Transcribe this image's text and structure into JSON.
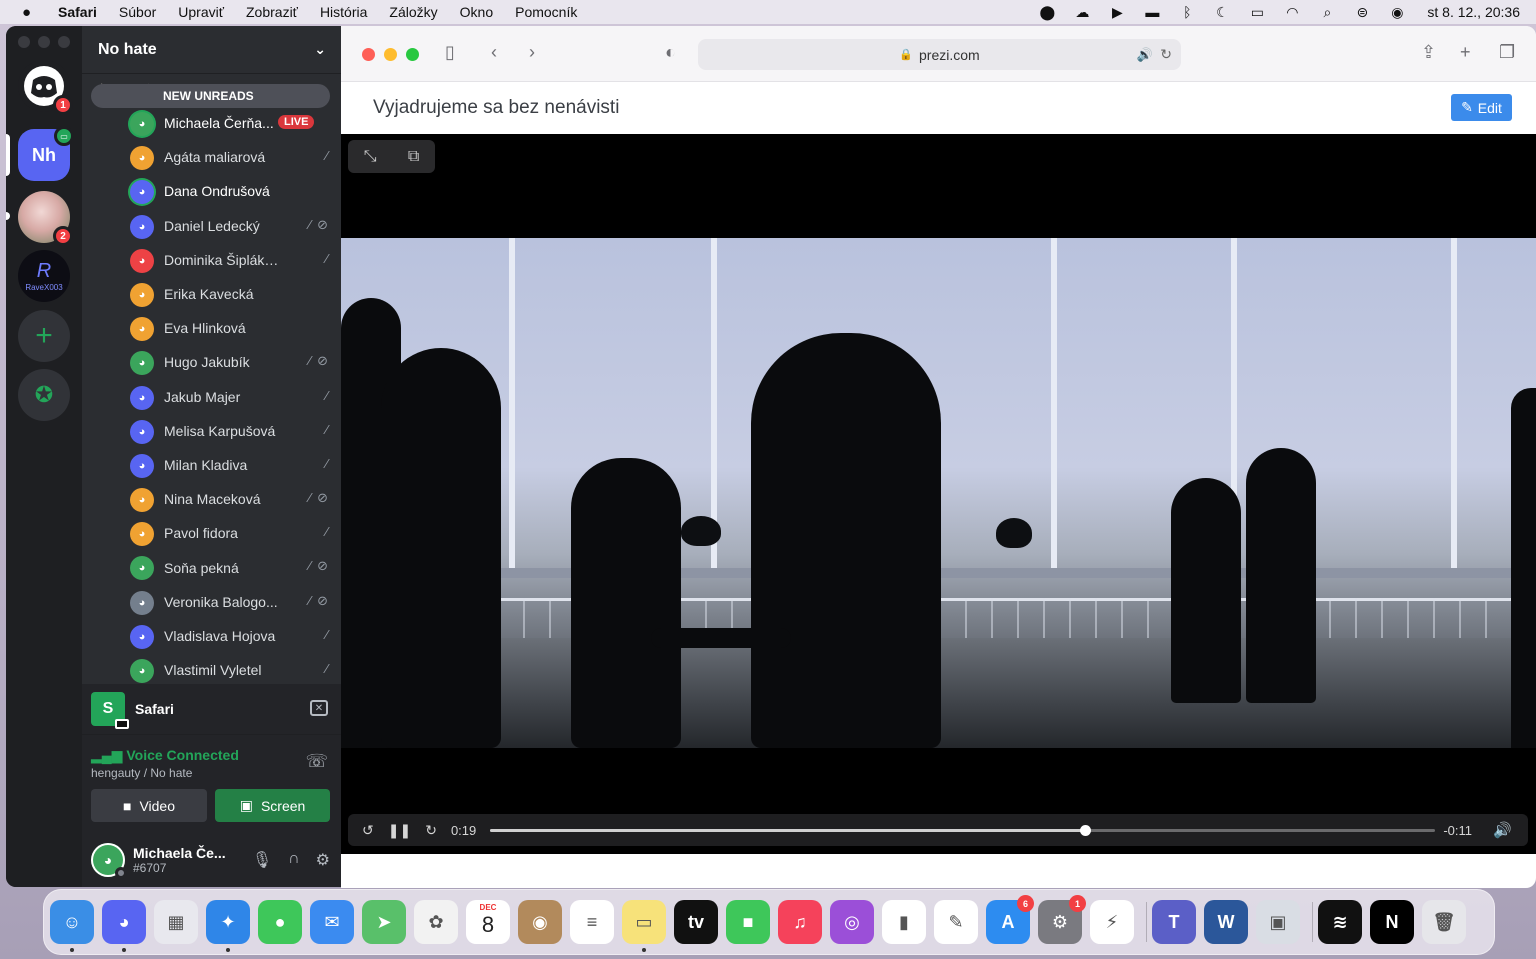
{
  "menubar": {
    "app_name": "Safari",
    "items": [
      "Súbor",
      "Upraviť",
      "Zobraziť",
      "História",
      "Záložky",
      "Okno",
      "Pomocník"
    ],
    "clock": "st 8. 12.,  20:36"
  },
  "discord": {
    "server_name": "No hate",
    "faded_channel": "hengauty",
    "new_unreads": "NEW UNREADS",
    "guild_nh": "Nh",
    "guild_home_badge": "1",
    "guild_pig_badge": "2",
    "guild_rave": "RaveX003",
    "members": [
      {
        "name": "Michaela Čerňa...",
        "color": "#3ba55c",
        "live": "LIVE",
        "icons": ""
      },
      {
        "name": "Agáta maliarová",
        "color": "#f0a232",
        "icons": "muted"
      },
      {
        "name": "Dana Ondrušová",
        "color": "#5865f2",
        "icons": ""
      },
      {
        "name": "Daniel Ledecký",
        "color": "#5865f2",
        "icons": "muted-deaf"
      },
      {
        "name": "Dominika Šipláková",
        "color": "#ed4245",
        "icons": "muted"
      },
      {
        "name": "Erika Kavecká",
        "color": "#f0a232",
        "icons": ""
      },
      {
        "name": "Eva Hlinková",
        "color": "#f0a232",
        "icons": ""
      },
      {
        "name": "Hugo Jakubík",
        "color": "#3ba55c",
        "icons": "muted-deaf"
      },
      {
        "name": "Jakub Majer",
        "color": "#5865f2",
        "icons": "muted"
      },
      {
        "name": "Melisa Karpušová",
        "color": "#5865f2",
        "icons": "muted"
      },
      {
        "name": "Milan Kladiva",
        "color": "#5865f2",
        "icons": "muted"
      },
      {
        "name": "Nina Maceková",
        "color": "#f0a232",
        "icons": "muted-deaf"
      },
      {
        "name": "Pavol fidora",
        "color": "#f0a232",
        "icons": "muted"
      },
      {
        "name": "Soňa pekná",
        "color": "#3ba55c",
        "icons": "muted-deaf"
      },
      {
        "name": "Veronika Balogo...",
        "color": "#747f8d",
        "icons": "muted-deaf"
      },
      {
        "name": "Vladislava Hojova",
        "color": "#5865f2",
        "icons": "muted"
      },
      {
        "name": "Vlastimil Vyletel",
        "color": "#3ba55c",
        "icons": "muted"
      }
    ],
    "stream": {
      "icon_letter": "S",
      "label": "Safari"
    },
    "voice": {
      "status": "Voice Connected",
      "location": "hengauty / No hate",
      "video_label": "Video",
      "screen_label": "Screen"
    },
    "user": {
      "name": "Michaela Če...",
      "tag": "#6707"
    }
  },
  "safari": {
    "url": "prezi.com"
  },
  "prezi": {
    "title": "Vyjadrujeme sa bez nenávisti",
    "edit_label": "Edit",
    "player": {
      "current_time": "0:19",
      "remaining_time": "-0:11",
      "progress_fraction": 0.63
    },
    "deck_progress_fraction": 0.5
  },
  "dock": {
    "calendar_month": "DEC",
    "calendar_day": "8",
    "appstore_badge": "6",
    "settings_badge": "1",
    "apps": [
      {
        "name": "finder",
        "color": "#3a8ee6",
        "glyph": "☺"
      },
      {
        "name": "discord",
        "color": "#5865f2",
        "glyph": "◕"
      },
      {
        "name": "launchpad",
        "color": "#e8e8ee",
        "glyph": "▦"
      },
      {
        "name": "safari",
        "color": "#2f86e8",
        "glyph": "✦"
      },
      {
        "name": "messages",
        "color": "#3ec75a",
        "glyph": "●"
      },
      {
        "name": "mail",
        "color": "#3b8bf0",
        "glyph": "✉"
      },
      {
        "name": "maps",
        "color": "#59c06a",
        "glyph": "➤"
      },
      {
        "name": "photos",
        "color": "#f2f2f2",
        "glyph": "✿"
      },
      {
        "name": "calendar",
        "color": "#ffffff",
        "glyph": ""
      },
      {
        "name": "contacts",
        "color": "#b28a5c",
        "glyph": "◉"
      },
      {
        "name": "reminders",
        "color": "#ffffff",
        "glyph": "≡"
      },
      {
        "name": "notes",
        "color": "#f7e27a",
        "glyph": "▭"
      },
      {
        "name": "apple-tv",
        "color": "#111111",
        "glyph": "tv"
      },
      {
        "name": "facetime",
        "color": "#3ec75a",
        "glyph": "■"
      },
      {
        "name": "music",
        "color": "#f5425b",
        "glyph": "♫"
      },
      {
        "name": "podcasts",
        "color": "#9b4fd8",
        "glyph": "◎"
      },
      {
        "name": "numbers",
        "color": "#ffffff",
        "glyph": "▮"
      },
      {
        "name": "pages",
        "color": "#ffffff",
        "glyph": "✎"
      },
      {
        "name": "app-store",
        "color": "#2d8cf0",
        "glyph": "A"
      },
      {
        "name": "system-settings",
        "color": "#7a7a80",
        "glyph": "⚙"
      },
      {
        "name": "messenger",
        "color": "#ffffff",
        "glyph": "⚡"
      },
      {
        "name": "teams",
        "color": "#5b5fc7",
        "glyph": "T"
      },
      {
        "name": "word",
        "color": "#2b579a",
        "glyph": "W"
      },
      {
        "name": "preview",
        "color": "#d9dde4",
        "glyph": "▣"
      },
      {
        "name": "spotify",
        "color": "#111111",
        "glyph": "≋"
      },
      {
        "name": "netflix",
        "color": "#000000",
        "glyph": "N"
      },
      {
        "name": "trash",
        "color": "#e6e6ea",
        "glyph": "🗑"
      }
    ]
  }
}
